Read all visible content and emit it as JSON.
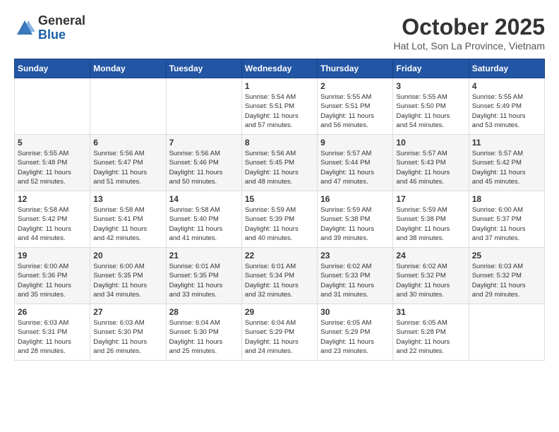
{
  "header": {
    "logo_line1": "General",
    "logo_line2": "Blue",
    "month_title": "October 2025",
    "subtitle": "Hat Lot, Son La Province, Vietnam"
  },
  "weekdays": [
    "Sunday",
    "Monday",
    "Tuesday",
    "Wednesday",
    "Thursday",
    "Friday",
    "Saturday"
  ],
  "weeks": [
    [
      {
        "day": "",
        "info": ""
      },
      {
        "day": "",
        "info": ""
      },
      {
        "day": "",
        "info": ""
      },
      {
        "day": "1",
        "info": "Sunrise: 5:54 AM\nSunset: 5:51 PM\nDaylight: 11 hours\nand 57 minutes."
      },
      {
        "day": "2",
        "info": "Sunrise: 5:55 AM\nSunset: 5:51 PM\nDaylight: 11 hours\nand 56 minutes."
      },
      {
        "day": "3",
        "info": "Sunrise: 5:55 AM\nSunset: 5:50 PM\nDaylight: 11 hours\nand 54 minutes."
      },
      {
        "day": "4",
        "info": "Sunrise: 5:55 AM\nSunset: 5:49 PM\nDaylight: 11 hours\nand 53 minutes."
      }
    ],
    [
      {
        "day": "5",
        "info": "Sunrise: 5:55 AM\nSunset: 5:48 PM\nDaylight: 11 hours\nand 52 minutes."
      },
      {
        "day": "6",
        "info": "Sunrise: 5:56 AM\nSunset: 5:47 PM\nDaylight: 11 hours\nand 51 minutes."
      },
      {
        "day": "7",
        "info": "Sunrise: 5:56 AM\nSunset: 5:46 PM\nDaylight: 11 hours\nand 50 minutes."
      },
      {
        "day": "8",
        "info": "Sunrise: 5:56 AM\nSunset: 5:45 PM\nDaylight: 11 hours\nand 48 minutes."
      },
      {
        "day": "9",
        "info": "Sunrise: 5:57 AM\nSunset: 5:44 PM\nDaylight: 11 hours\nand 47 minutes."
      },
      {
        "day": "10",
        "info": "Sunrise: 5:57 AM\nSunset: 5:43 PM\nDaylight: 11 hours\nand 46 minutes."
      },
      {
        "day": "11",
        "info": "Sunrise: 5:57 AM\nSunset: 5:42 PM\nDaylight: 11 hours\nand 45 minutes."
      }
    ],
    [
      {
        "day": "12",
        "info": "Sunrise: 5:58 AM\nSunset: 5:42 PM\nDaylight: 11 hours\nand 44 minutes."
      },
      {
        "day": "13",
        "info": "Sunrise: 5:58 AM\nSunset: 5:41 PM\nDaylight: 11 hours\nand 42 minutes."
      },
      {
        "day": "14",
        "info": "Sunrise: 5:58 AM\nSunset: 5:40 PM\nDaylight: 11 hours\nand 41 minutes."
      },
      {
        "day": "15",
        "info": "Sunrise: 5:59 AM\nSunset: 5:39 PM\nDaylight: 11 hours\nand 40 minutes."
      },
      {
        "day": "16",
        "info": "Sunrise: 5:59 AM\nSunset: 5:38 PM\nDaylight: 11 hours\nand 39 minutes."
      },
      {
        "day": "17",
        "info": "Sunrise: 5:59 AM\nSunset: 5:38 PM\nDaylight: 11 hours\nand 38 minutes."
      },
      {
        "day": "18",
        "info": "Sunrise: 6:00 AM\nSunset: 5:37 PM\nDaylight: 11 hours\nand 37 minutes."
      }
    ],
    [
      {
        "day": "19",
        "info": "Sunrise: 6:00 AM\nSunset: 5:36 PM\nDaylight: 11 hours\nand 35 minutes."
      },
      {
        "day": "20",
        "info": "Sunrise: 6:00 AM\nSunset: 5:35 PM\nDaylight: 11 hours\nand 34 minutes."
      },
      {
        "day": "21",
        "info": "Sunrise: 6:01 AM\nSunset: 5:35 PM\nDaylight: 11 hours\nand 33 minutes."
      },
      {
        "day": "22",
        "info": "Sunrise: 6:01 AM\nSunset: 5:34 PM\nDaylight: 11 hours\nand 32 minutes."
      },
      {
        "day": "23",
        "info": "Sunrise: 6:02 AM\nSunset: 5:33 PM\nDaylight: 11 hours\nand 31 minutes."
      },
      {
        "day": "24",
        "info": "Sunrise: 6:02 AM\nSunset: 5:32 PM\nDaylight: 11 hours\nand 30 minutes."
      },
      {
        "day": "25",
        "info": "Sunrise: 6:03 AM\nSunset: 5:32 PM\nDaylight: 11 hours\nand 29 minutes."
      }
    ],
    [
      {
        "day": "26",
        "info": "Sunrise: 6:03 AM\nSunset: 5:31 PM\nDaylight: 11 hours\nand 28 minutes."
      },
      {
        "day": "27",
        "info": "Sunrise: 6:03 AM\nSunset: 5:30 PM\nDaylight: 11 hours\nand 26 minutes."
      },
      {
        "day": "28",
        "info": "Sunrise: 6:04 AM\nSunset: 5:30 PM\nDaylight: 11 hours\nand 25 minutes."
      },
      {
        "day": "29",
        "info": "Sunrise: 6:04 AM\nSunset: 5:29 PM\nDaylight: 11 hours\nand 24 minutes."
      },
      {
        "day": "30",
        "info": "Sunrise: 6:05 AM\nSunset: 5:29 PM\nDaylight: 11 hours\nand 23 minutes."
      },
      {
        "day": "31",
        "info": "Sunrise: 6:05 AM\nSunset: 5:28 PM\nDaylight: 11 hours\nand 22 minutes."
      },
      {
        "day": "",
        "info": ""
      }
    ]
  ]
}
